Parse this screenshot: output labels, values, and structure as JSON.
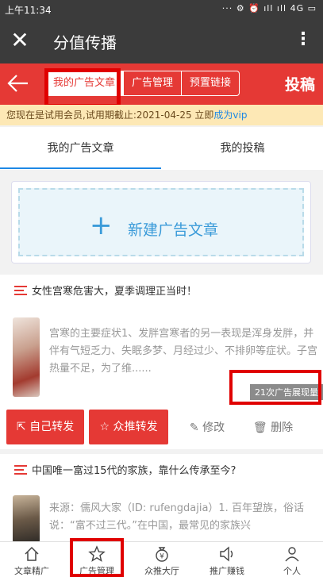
{
  "status_bar": {
    "time": "上午11:34",
    "icons": "··· ⚙ ⏰ ıll ıll 4G ▭"
  },
  "title_bar": {
    "title": "分值传播",
    "close_icon": "close-icon",
    "more_icon": "more-icon"
  },
  "header": {
    "tabs": [
      "我的广告文章",
      "广告管理",
      "预置链接"
    ],
    "active_tab": 0,
    "post_label": "投稿",
    "accent": "#e53935"
  },
  "notice": {
    "text": "您现在是试用会员,试用期截止:2021-04-25 立即",
    "link": "成为vip"
  },
  "sub_tabs": [
    "我的广告文章",
    "我的投稿"
  ],
  "create_button": {
    "label": "新建广告文章"
  },
  "articles": [
    {
      "title": "女性宫寒危害大，夏季调理正当时！",
      "excerpt": "宫寒的主要症状1、发胖宫寒者的另一表现是浑身发胖，并伴有气短乏力、失眠多梦、月经过少、不排卵等症状。子宫热量不足，为了维......",
      "badge": "21次广告展现量",
      "actions": {
        "forward_self": "自己转发",
        "forward_push": "众推转发",
        "edit": "修改",
        "delete": "删除"
      }
    },
    {
      "title": "中国唯一富过15代的家族，靠什么传承至今?",
      "excerpt": "来源：儒风大家（ID: rufengdajia）1. 百年望族，俗话说：“富不过三代。”在中国，最常见的家族兴"
    }
  ],
  "bottom_nav": [
    "文章精广",
    "广告管理",
    "众推大厅",
    "推广赚钱",
    "个人"
  ]
}
